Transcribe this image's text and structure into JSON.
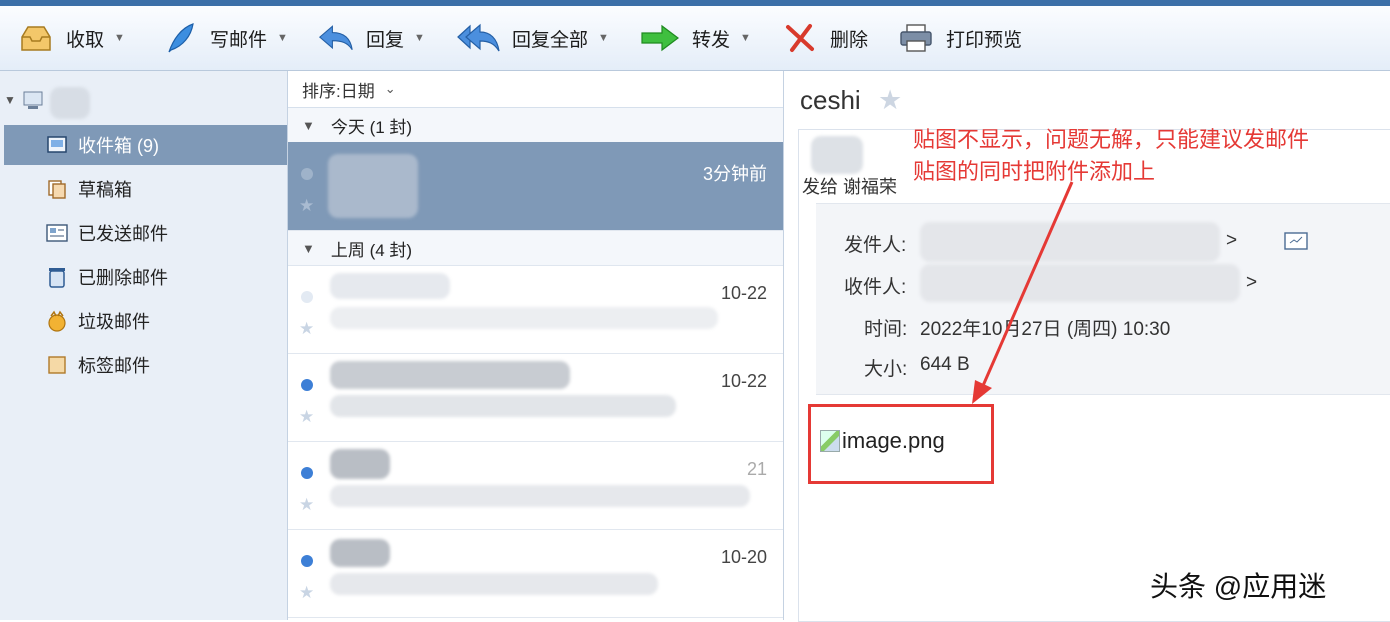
{
  "toolbar": {
    "receive": "收取",
    "compose": "写邮件",
    "reply": "回复",
    "reply_all": "回复全部",
    "forward": "转发",
    "delete": "删除",
    "print_preview": "打印预览"
  },
  "sidebar": {
    "items": [
      {
        "label": "收件箱 (9)",
        "icon": "inbox-icon"
      },
      {
        "label": "草稿箱",
        "icon": "drafts-icon"
      },
      {
        "label": "已发送邮件",
        "icon": "sent-icon"
      },
      {
        "label": "已删除邮件",
        "icon": "trash-icon"
      },
      {
        "label": "垃圾邮件",
        "icon": "spam-icon"
      },
      {
        "label": "标签邮件",
        "icon": "tag-icon"
      }
    ]
  },
  "list": {
    "sort_label": "排序:日期",
    "groups": [
      {
        "label": "今天 (1 封)"
      },
      {
        "label": "上周 (4 封)"
      }
    ],
    "rows": [
      {
        "date": "3分钟前"
      },
      {
        "date": "10-22"
      },
      {
        "date": "10-22"
      },
      {
        "date": "21"
      },
      {
        "date": "10-20"
      }
    ]
  },
  "message": {
    "subject": "ceshi",
    "send_to": "发给 谢福荣",
    "from_label": "发件人:",
    "from_suffix": ">",
    "to_label": "收件人:",
    "to_suffix": ">",
    "time_label": "时间:",
    "time_value": "2022年10月27日 (周四) 10:30",
    "size_label": "大小:",
    "size_value": "644 B",
    "attachment_name": "image.png"
  },
  "annotation": {
    "line1": "贴图不显示，问题无解，只能建议发邮件",
    "line2": "贴图的同时把附件添加上"
  },
  "watermark": "头条 @应用迷",
  "colors": {
    "selection": "#7f99b7",
    "annotation": "#e53935",
    "unread_dot": "#3d7fd6"
  }
}
